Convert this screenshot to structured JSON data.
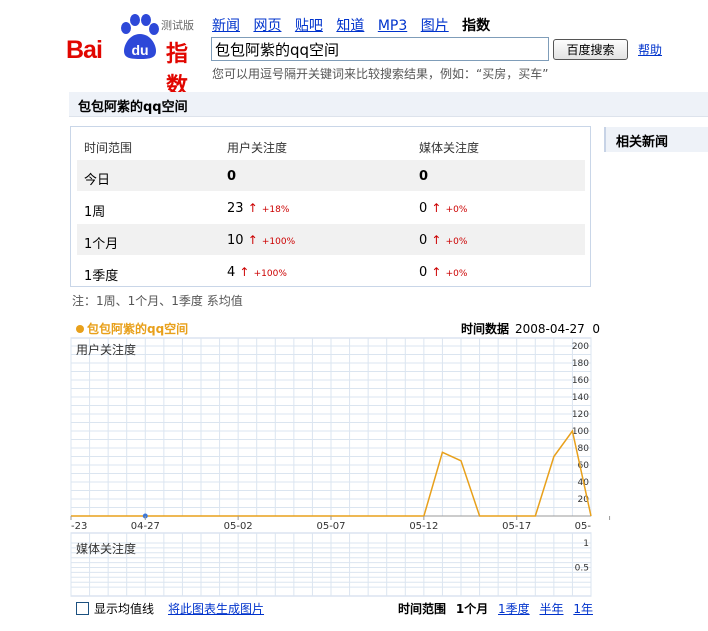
{
  "logo": {
    "text_bai": "Bai",
    "text_du": "du",
    "text_product": "指数",
    "beta_label": "测试版"
  },
  "nav": {
    "items": [
      "新闻",
      "网页",
      "贴吧",
      "知道",
      "MP3",
      "图片"
    ],
    "current": "指数"
  },
  "search": {
    "value": "包包阿紫的qq空间",
    "button_label": "百度搜索",
    "help_label": "帮助"
  },
  "hint": "您可以用逗号隔开关键词来比较搜索结果，例如：“买房，买车”",
  "query_title": "包包阿紫的qq空间",
  "related_news_title": "相关新闻",
  "stats": {
    "headers": [
      "时间范围",
      "用户关注度",
      "媒体关注度"
    ],
    "rows": [
      {
        "range": "今日",
        "user": "0",
        "user_change": "",
        "media": "0",
        "media_change": ""
      },
      {
        "range": "1周",
        "user": "23",
        "user_change": "+18%",
        "media": "0",
        "media_change": "+0%"
      },
      {
        "range": "1个月",
        "user": "10",
        "user_change": "+100%",
        "media": "0",
        "media_change": "+0%"
      },
      {
        "range": "1季度",
        "user": "4",
        "user_change": "+100%",
        "media": "0",
        "media_change": "+0%"
      }
    ],
    "up_arrow": "↑"
  },
  "note": "注：1周、1个月、1季度 系均值",
  "chart_header": {
    "series_label": "包包阿紫的qq空间",
    "time_label": "时间数据",
    "time_value": "2008-04-27",
    "time_count": "0"
  },
  "chart_data": [
    {
      "type": "line",
      "title": "用户关注度",
      "series": [
        {
          "name": "包包阿紫的qq空间",
          "x": [
            "2008-04-23",
            "2008-04-24",
            "2008-04-25",
            "2008-04-26",
            "2008-04-27",
            "2008-04-28",
            "2008-04-29",
            "2008-04-30",
            "2008-05-01",
            "2008-05-02",
            "2008-05-03",
            "2008-05-04",
            "2008-05-05",
            "2008-05-06",
            "2008-05-07",
            "2008-05-08",
            "2008-05-09",
            "2008-05-10",
            "2008-05-11",
            "2008-05-12",
            "2008-05-13",
            "2008-05-14",
            "2008-05-15",
            "2008-05-16",
            "2008-05-17",
            "2008-05-18",
            "2008-05-19",
            "2008-05-20",
            "2008-05-21"
          ],
          "values": [
            0,
            0,
            0,
            0,
            0,
            0,
            0,
            0,
            0,
            0,
            0,
            0,
            0,
            0,
            0,
            0,
            0,
            0,
            0,
            0,
            75,
            65,
            0,
            0,
            0,
            0,
            70,
            100,
            0
          ]
        }
      ],
      "x_ticks": [
        "-23",
        "04-27",
        "05-02",
        "05-07",
        "05-12",
        "05-17",
        "05-"
      ],
      "y_ticks": [
        "200",
        "180",
        "160",
        "140",
        "120",
        "100",
        "80",
        "60",
        "40",
        "20"
      ],
      "ylim": [
        0,
        200
      ],
      "highlight_point": "2008-04-27"
    },
    {
      "type": "line",
      "title": "媒体关注度",
      "series": [],
      "y_ticks": [
        "1",
        "0.5"
      ],
      "ylim": [
        0,
        1
      ]
    }
  ],
  "footer": {
    "show_avg_label": "显示均值线",
    "export_label": "将此图表生成图片",
    "range_label": "时间范围",
    "ranges": [
      "1个月",
      "1季度",
      "半年",
      "1年"
    ],
    "current_range": "1个月"
  },
  "colors": {
    "brand_red": "#e10600",
    "line": "#e8a01b",
    "grid": "#dbe5f0",
    "link": "#0033cc"
  }
}
